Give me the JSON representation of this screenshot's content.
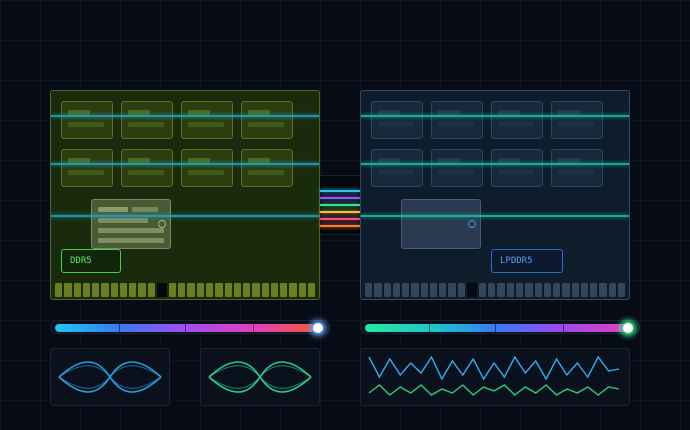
{
  "modules": {
    "ddr5": {
      "label": "DDR5",
      "accent": "#3fcf4a"
    },
    "lpddr5": {
      "label": "LPDDR5",
      "accent": "#2f6ad0"
    }
  },
  "bus": {
    "wire_colors": [
      "#29c6f2",
      "#8b5cf6",
      "#38e08a",
      "#f0c23a",
      "#f0508a",
      "#ff7a30"
    ]
  },
  "bandwidth_rails": {
    "ddr5": {
      "gradient": [
        "#1ec8f0",
        "#3a7af0",
        "#a24ef0",
        "#e040c0",
        "#f05a3a"
      ],
      "glow": "#5aa0ff"
    },
    "lpddr5": {
      "gradient": [
        "#28e8a0",
        "#20c8c8",
        "#3a7af0",
        "#9c4af0",
        "#e040c0"
      ],
      "glow": "#3af08a"
    }
  },
  "signal_panels": {
    "eye_a": {
      "color": "#2aa8e0"
    },
    "eye_b": {
      "color": "#28d896"
    },
    "waveform": {
      "top_color": "#2ab0f0",
      "bottom_color": "#2ad07a"
    }
  }
}
